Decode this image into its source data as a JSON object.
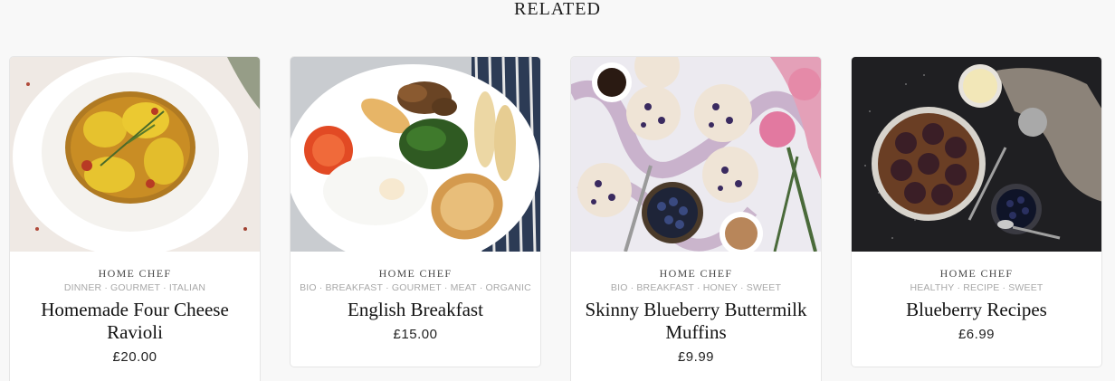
{
  "section": {
    "title": "RELATED"
  },
  "cards": [
    {
      "author": "HOME CHEF",
      "tags": [
        "DINNER",
        "GOURMET",
        "ITALIAN"
      ],
      "title": "Homemade Four Cheese Ravioli",
      "price": "£20.00",
      "image": "ravioli-photo"
    },
    {
      "author": "HOME CHEF",
      "tags": [
        "BIO",
        "BREAKFAST",
        "GOURMET",
        "MEAT",
        "ORGANIC"
      ],
      "title": "English Breakfast",
      "price": "£15.00",
      "image": "english-breakfast-photo"
    },
    {
      "author": "HOME CHEF",
      "tags": [
        "BIO",
        "BREAKFAST",
        "HONEY",
        "SWEET"
      ],
      "title": "Skinny Blueberry Buttermilk Muffins",
      "price": "£9.99",
      "image": "blueberry-muffins-photo"
    },
    {
      "author": "HOME CHEF",
      "tags": [
        "HEALTHY",
        "RECIPE",
        "SWEET"
      ],
      "title": "Blueberry Recipes",
      "price": "£6.99",
      "image": "blueberry-rolls-photo"
    }
  ],
  "colors": {
    "background": "#f8f8f8",
    "card": "#ffffff",
    "tag_text": "#a8a8a8",
    "title_text": "#111111"
  }
}
